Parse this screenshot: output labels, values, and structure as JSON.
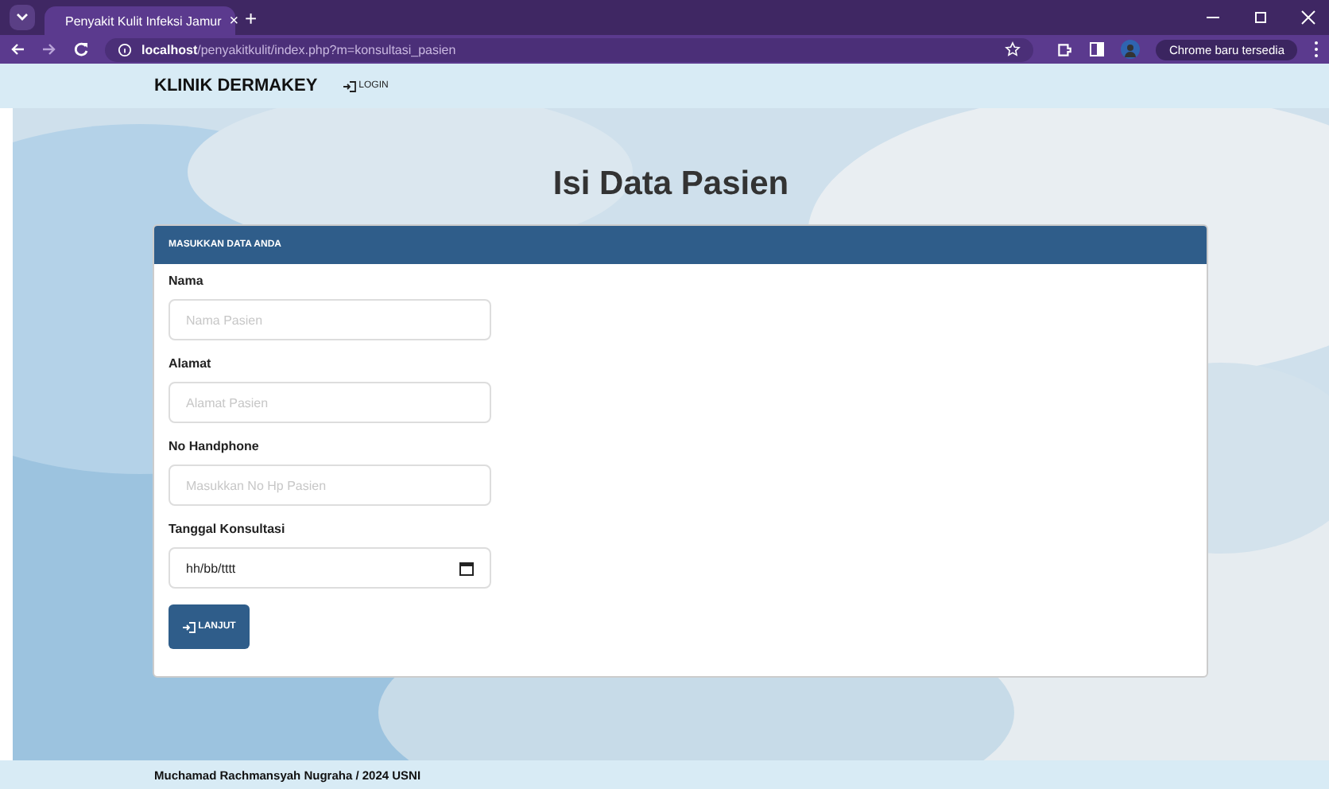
{
  "browser": {
    "tabs": [
      {
        "title": "Penyakit Kulit Infeksi Jamur",
        "selected": true
      }
    ],
    "close_tab": "×",
    "new_tab": "+",
    "url_host": "localhost",
    "url_path": "/penyakitkulit/index.php?m=konsultasi_pasien",
    "update_button": "Chrome baru tersedia"
  },
  "navbar": {
    "brand": "KLINIK DERMAKEY",
    "login": "LOGIN"
  },
  "page_title": "Isi Data Pasien",
  "card": {
    "header": "MASUKKAN DATA ANDA",
    "fields": [
      {
        "kind": "text",
        "label": "Nama",
        "placeholder": "Nama Pasien"
      },
      {
        "kind": "text",
        "label": "Alamat",
        "placeholder": "Alamat Pasien"
      },
      {
        "kind": "text",
        "label": "No Handphone",
        "placeholder": "Masukkan No Hp Pasien"
      },
      {
        "kind": "date",
        "label": "Tanggal Konsultasi",
        "value": "hh/bb/tttt"
      }
    ],
    "submit": "LANJUT"
  },
  "footer": "Muchamad Rachmansyah Nugraha / 2024 USNI"
}
